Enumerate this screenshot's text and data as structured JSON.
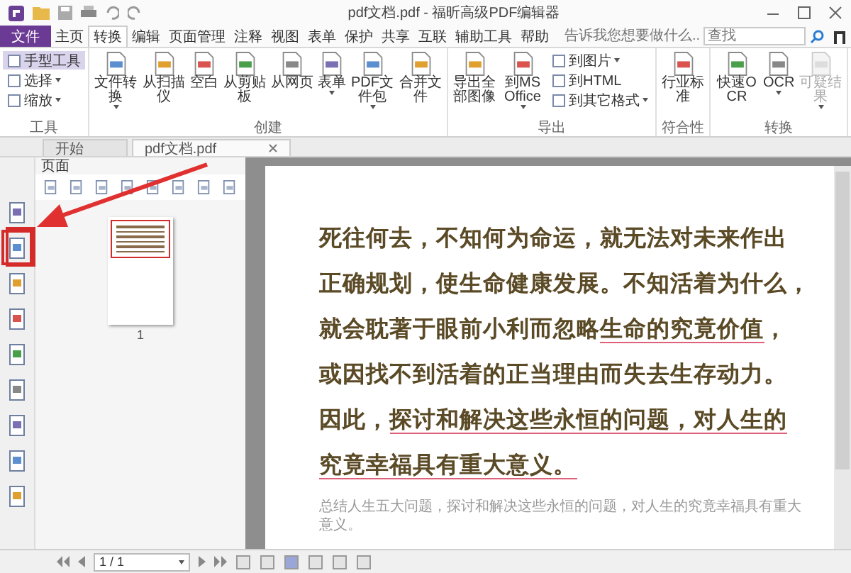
{
  "title_bar": {
    "title": "pdf文档.pdf - 福昕高级PDF编辑器"
  },
  "menu_tabs": [
    {
      "label": "文件",
      "kind": "file",
      "selected": false
    },
    {
      "label": "主页",
      "kind": "tab",
      "selected": false
    },
    {
      "label": "转换",
      "kind": "tab",
      "selected": true
    },
    {
      "label": "编辑",
      "kind": "tab",
      "selected": false
    },
    {
      "label": "页面管理",
      "kind": "tab",
      "selected": false
    },
    {
      "label": "注释",
      "kind": "tab",
      "selected": false
    },
    {
      "label": "视图",
      "kind": "tab",
      "selected": false
    },
    {
      "label": "表单",
      "kind": "tab",
      "selected": false
    },
    {
      "label": "保护",
      "kind": "tab",
      "selected": false
    },
    {
      "label": "共享",
      "kind": "tab",
      "selected": false
    },
    {
      "label": "互联",
      "kind": "tab",
      "selected": false
    },
    {
      "label": "辅助工具",
      "kind": "tab",
      "selected": false
    },
    {
      "label": "帮助",
      "kind": "tab",
      "selected": false
    }
  ],
  "tell_me": {
    "placeholder": "告诉我您想要做什么..."
  },
  "search": {
    "placeholder": "查找"
  },
  "ribbon": {
    "groups": [
      {
        "label": "工具",
        "items": [
          {
            "label": "手型工具",
            "kind": "small",
            "selected": true,
            "dropdown": false
          },
          {
            "label": "选择",
            "kind": "small",
            "selected": false,
            "dropdown": true
          },
          {
            "label": "缩放",
            "kind": "small",
            "selected": false,
            "dropdown": true
          }
        ]
      },
      {
        "label": "创建",
        "items": [
          {
            "label": "文件转换",
            "kind": "large",
            "dropdown": true,
            "disabled": false
          },
          {
            "label": "从扫描仪",
            "kind": "large",
            "dropdown": false,
            "disabled": false
          },
          {
            "label": "空白",
            "kind": "large",
            "dropdown": false,
            "disabled": false
          },
          {
            "label": "从剪贴板",
            "kind": "large",
            "dropdown": false,
            "disabled": false
          },
          {
            "label": "从网页",
            "kind": "large",
            "dropdown": false,
            "disabled": false
          },
          {
            "label": "表单",
            "kind": "large",
            "dropdown": true,
            "disabled": false
          },
          {
            "label": "PDF文件包",
            "kind": "large",
            "dropdown": true,
            "disabled": false
          },
          {
            "label": "合并文件",
            "kind": "large",
            "dropdown": false,
            "disabled": false
          }
        ]
      },
      {
        "label": "导出",
        "items": [
          {
            "label": "导出全部图像",
            "kind": "large",
            "dropdown": false,
            "disabled": false
          },
          {
            "label": "到MS Office",
            "kind": "large",
            "dropdown": true,
            "disabled": false
          },
          {
            "label": "到图片",
            "kind": "small",
            "dropdown": true
          },
          {
            "label": "到HTML",
            "kind": "small",
            "dropdown": false
          },
          {
            "label": "到其它格式",
            "kind": "small",
            "dropdown": true
          }
        ]
      },
      {
        "label": "符合性",
        "items": [
          {
            "label": "行业标准",
            "kind": "large",
            "dropdown": false,
            "disabled": false
          }
        ]
      },
      {
        "label": "转换",
        "items": [
          {
            "label": "快速OCR",
            "kind": "large",
            "dropdown": false,
            "disabled": false
          },
          {
            "label": "OCR",
            "kind": "large",
            "dropdown": true,
            "disabled": false
          },
          {
            "label": "可疑结果",
            "kind": "large",
            "dropdown": true,
            "disabled": true
          }
        ]
      }
    ]
  },
  "doc_tabs": [
    {
      "label": "开始",
      "selected": false,
      "closable": false
    },
    {
      "label": "pdf文档.pdf",
      "selected": true,
      "closable": true
    }
  ],
  "pages_panel": {
    "title": "页面",
    "thumbnails": [
      {
        "label": "1",
        "selected": true
      }
    ]
  },
  "document": {
    "lines": [
      [
        {
          "text": "死往何去，不知何为命运，就无法对未来作出",
          "underlined": false
        }
      ],
      [
        {
          "text": "正确规划，使生命健康发展。不知活着为什么，",
          "underlined": false
        }
      ],
      [
        {
          "text": "就会耽著于眼前小利而忽略",
          "underlined": false
        },
        {
          "text": "生命的究竟价值",
          "underlined": true
        },
        {
          "text": "，",
          "underlined": false
        }
      ],
      [
        {
          "text": "或因找不到活着的正当理由而失去生存动力。",
          "underlined": false
        }
      ],
      [
        {
          "text": "因此，",
          "underlined": false
        },
        {
          "text": "探讨和解决这些永恒的问题，对人生的",
          "underlined": true
        }
      ],
      [
        {
          "text": "究竟幸福具有重大意义。",
          "underlined": true
        }
      ]
    ],
    "caption": "总结人生五大问题，探讨和解决这些永恒的问题，对人生的究竟幸福具有重大意义。"
  },
  "status_bar": {
    "page": "1 / 1"
  }
}
